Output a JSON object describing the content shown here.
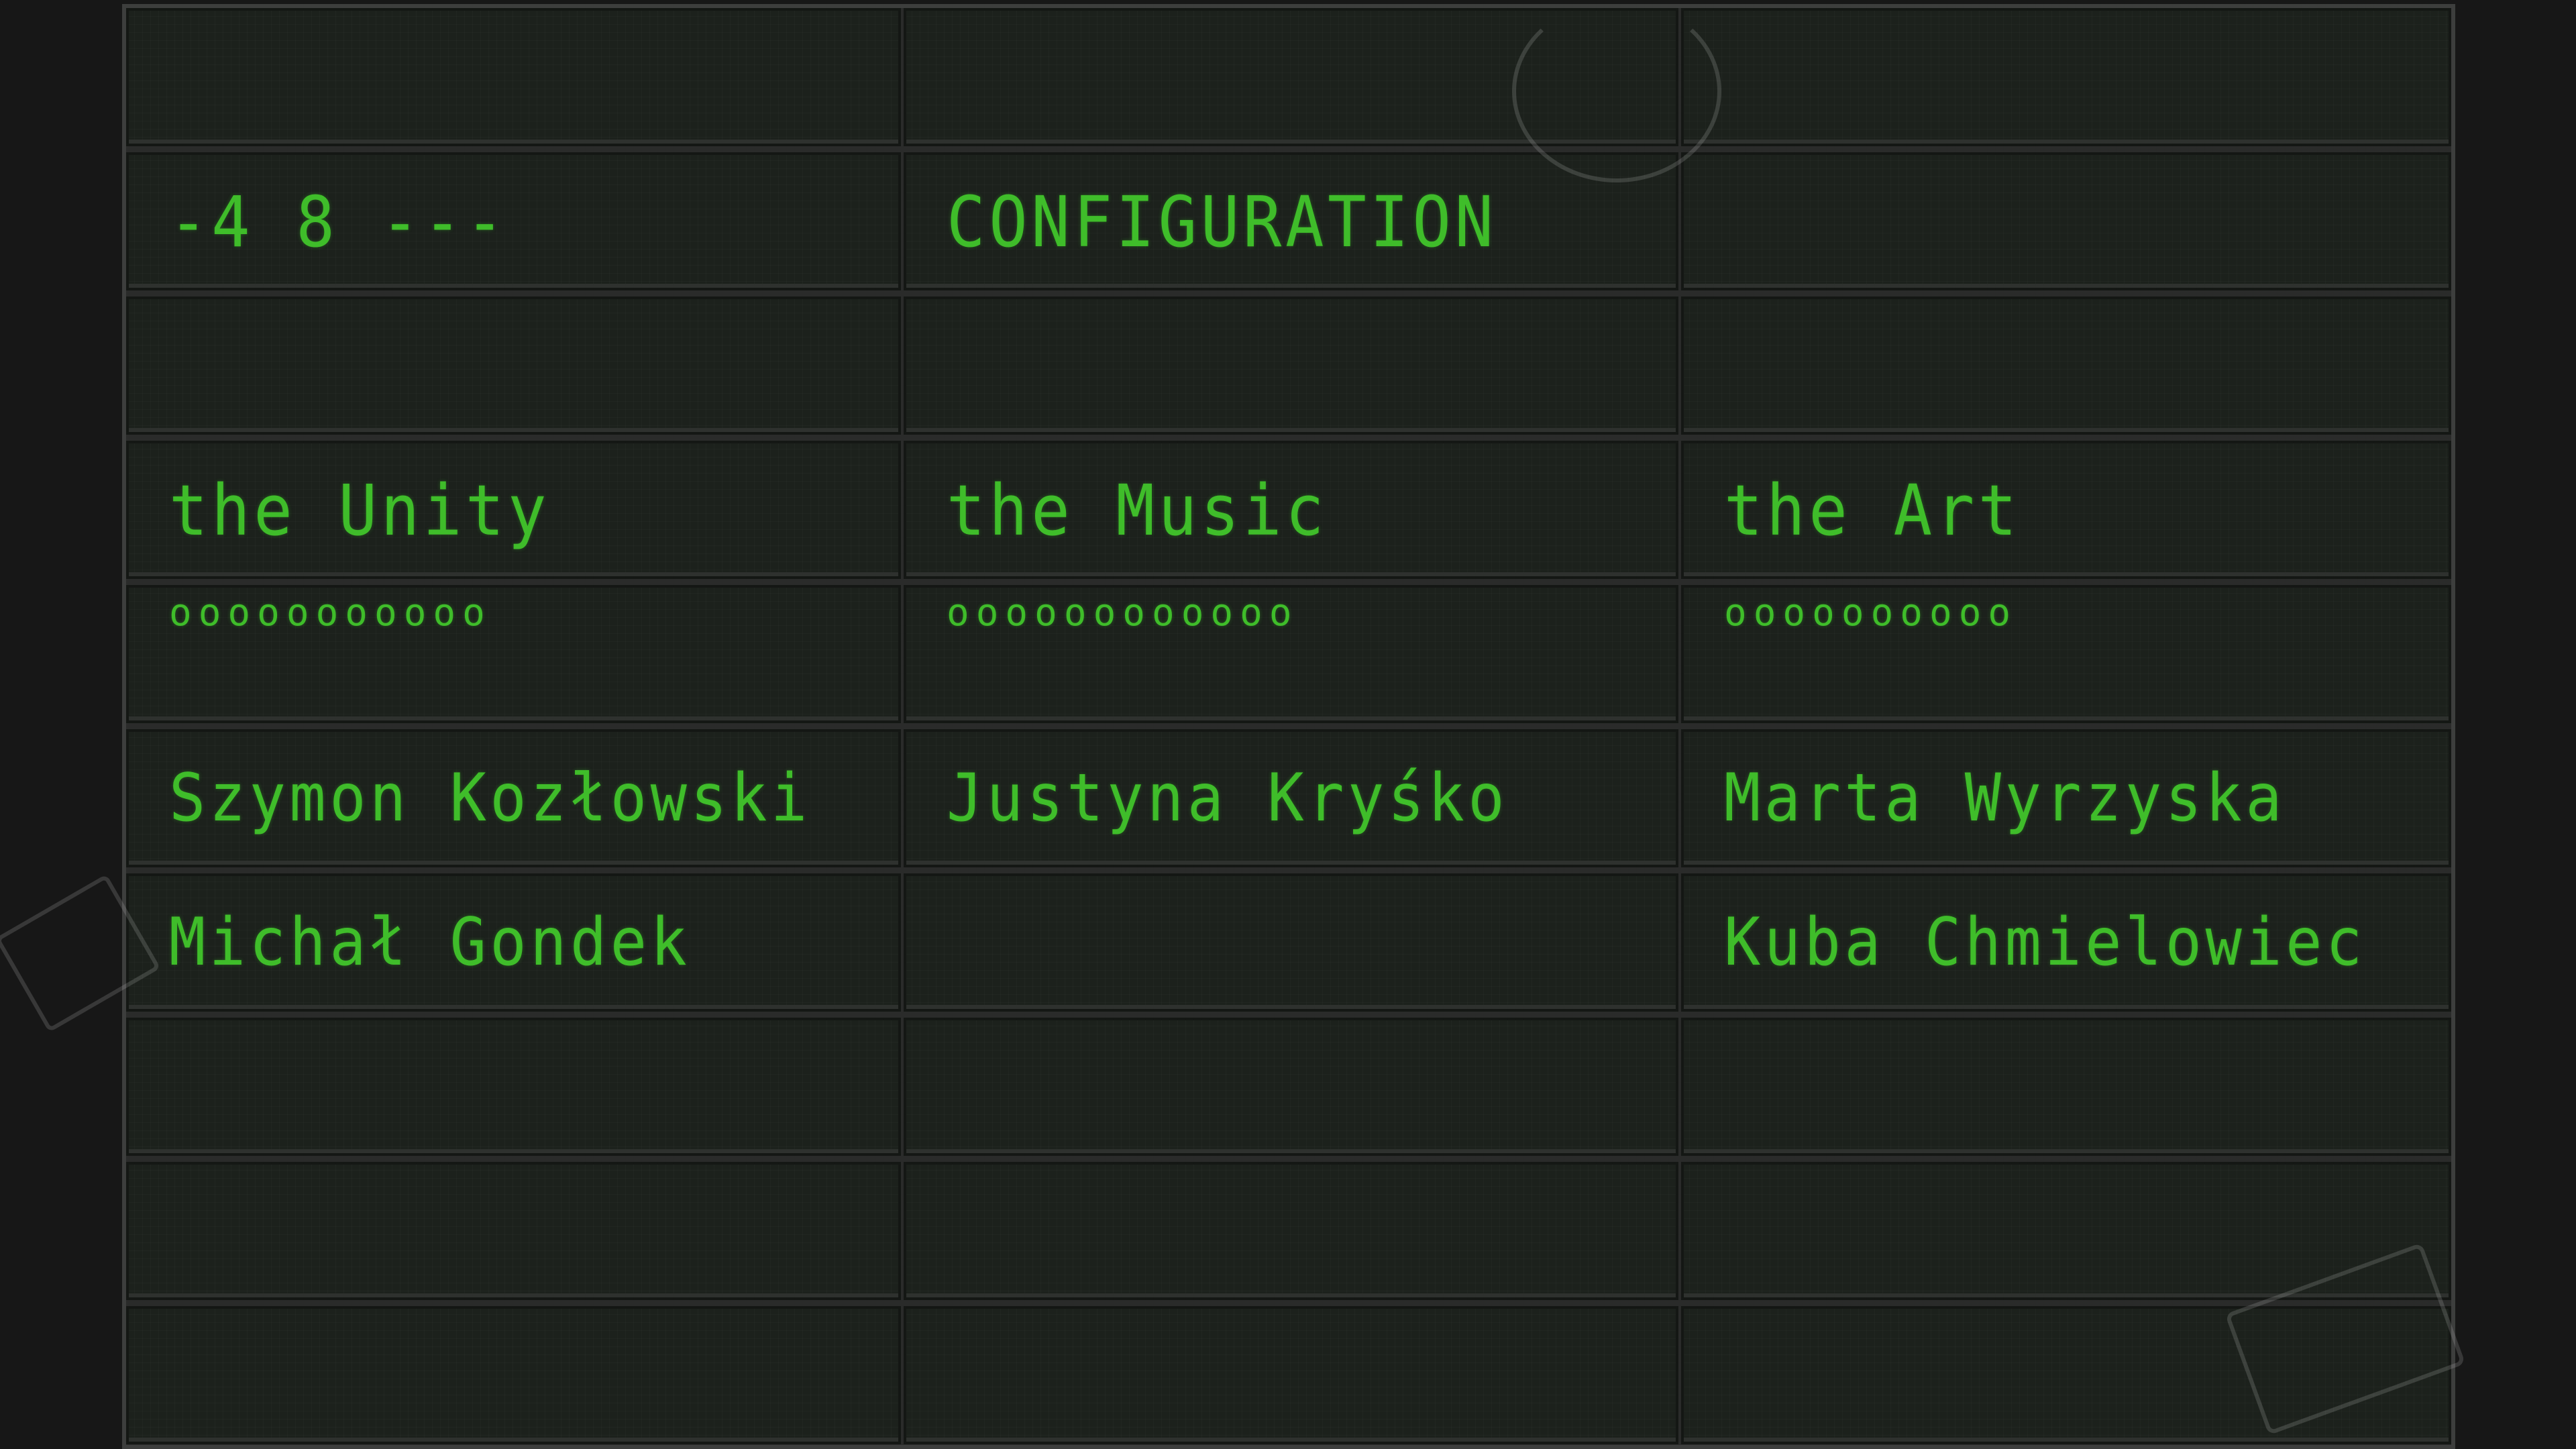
{
  "board": {
    "rows": [
      {
        "cells": [
          "",
          "",
          ""
        ]
      },
      {
        "cells": [
          "-4 8 ---",
          "CONFIGURATION",
          ""
        ]
      },
      {
        "cells": [
          "",
          "",
          ""
        ]
      },
      {
        "cells": [
          "the Unity",
          "the Music",
          "the Art"
        ]
      },
      {
        "cells": [
          "ooooooooooo",
          "oooooooooooo",
          "oooooooooo"
        ]
      },
      {
        "cells": [
          "Szymon Kozłowski",
          "Justyna Kryśko",
          "Marta Wyrzyska"
        ]
      },
      {
        "cells": [
          "Michał Gondek",
          "",
          "Kuba Chmielowiec"
        ]
      },
      {
        "cells": [
          "",
          "",
          ""
        ]
      },
      {
        "cells": [
          "",
          "",
          ""
        ]
      },
      {
        "cells": [
          "",
          "",
          ""
        ]
      }
    ]
  },
  "colors": {
    "lcd_text": "#3fbd2a",
    "cell_bg": "#1c211c",
    "frame": "#2a2b2a",
    "background": "#171717"
  },
  "decor": [
    "postmark-stamp-icon",
    "corner-stamp-left-icon",
    "corner-stamp-right-icon"
  ]
}
